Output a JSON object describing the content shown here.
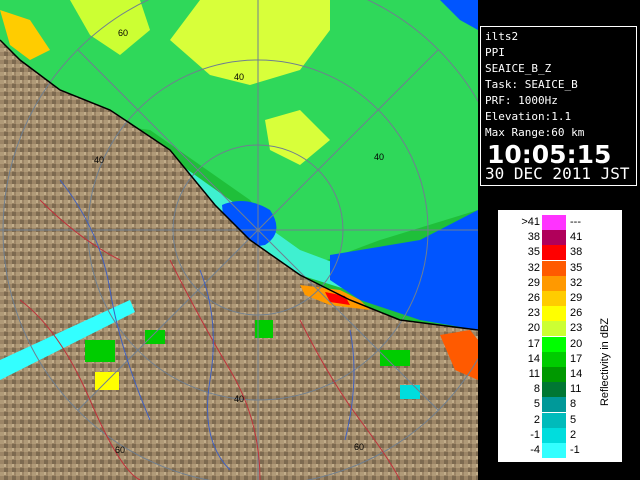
{
  "info": {
    "site": "ilts2",
    "product": "PPI",
    "mode": "SEAICE_B_Z",
    "task": "Task: SEAICE_B",
    "prf": "PRF: 1000Hz",
    "elevation": "Elevation:1.1",
    "max_range": "Max Range:60 km",
    "time": "10:05:15",
    "date": "30 DEC 2011 JST"
  },
  "range_ring_labels": [
    "60",
    "40",
    "40",
    "40",
    "40",
    "60",
    "60"
  ],
  "legend": {
    "unit_label": "Reflectivity in dBZ",
    "rows": [
      {
        "min": ">41",
        "max": "---",
        "color": "#ff33ff"
      },
      {
        "min": "38",
        "max": "41",
        "color": "#b0005a"
      },
      {
        "min": "35",
        "max": "38",
        "color": "#ff0000"
      },
      {
        "min": "32",
        "max": "35",
        "color": "#ff5a00"
      },
      {
        "min": "29",
        "max": "32",
        "color": "#ff9900"
      },
      {
        "min": "26",
        "max": "29",
        "color": "#ffcc00"
      },
      {
        "min": "23",
        "max": "26",
        "color": "#ffff00"
      },
      {
        "min": "20",
        "max": "23",
        "color": "#ccff33"
      },
      {
        "min": "17",
        "max": "20",
        "color": "#00ff00"
      },
      {
        "min": "14",
        "max": "17",
        "color": "#00cc00"
      },
      {
        "min": "11",
        "max": "14",
        "color": "#009900"
      },
      {
        "min": "8",
        "max": "11",
        "color": "#007733"
      },
      {
        "min": "5",
        "max": "8",
        "color": "#009999"
      },
      {
        "min": "2",
        "max": "5",
        "color": "#00bbbb"
      },
      {
        "min": "-1",
        "max": "2",
        "color": "#00dddd"
      },
      {
        "min": "-4",
        "max": "-1",
        "color": "#33ffff"
      }
    ]
  },
  "colors": {
    "land": "#a08a6a",
    "sea_ice": "#0055ff",
    "ring": "#6f7f90",
    "boundary": "#c0303a"
  }
}
